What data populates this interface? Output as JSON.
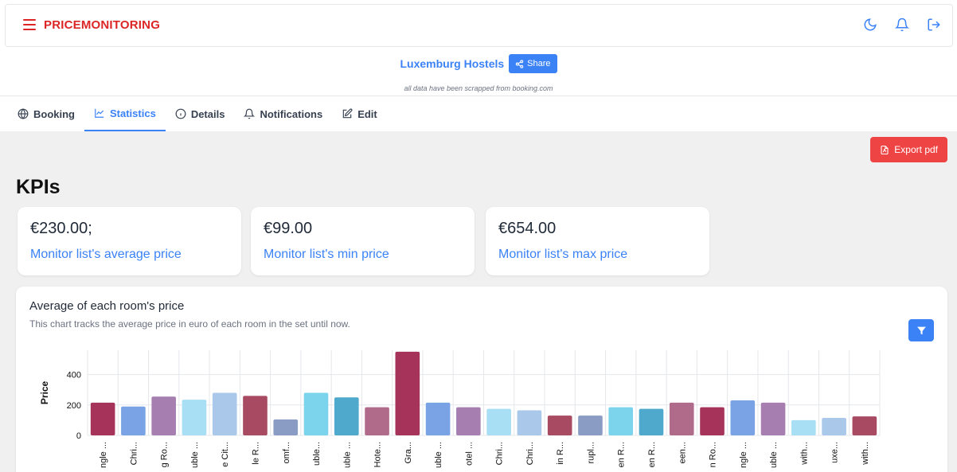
{
  "topbar": {
    "brand": "PRICEMONITORING",
    "icons": [
      "menu-icon",
      "moon-icon",
      "bell-icon",
      "logout-icon"
    ]
  },
  "header": {
    "title": "Luxemburg Hostels",
    "share_label": "Share",
    "note": "all data have been scrapped from booking.com"
  },
  "tabs": [
    {
      "label": "Booking",
      "icon": "globe-icon",
      "active": false
    },
    {
      "label": "Statistics",
      "icon": "chart-line-icon",
      "active": true
    },
    {
      "label": "Details",
      "icon": "info-icon",
      "active": false
    },
    {
      "label": "Notifications",
      "icon": "bell-icon",
      "active": false
    },
    {
      "label": "Edit",
      "icon": "edit-icon",
      "active": false
    }
  ],
  "main": {
    "export_label": "Export pdf",
    "kpis_title": "KPIs",
    "kpis": [
      {
        "value": "€230.00;",
        "label": "Monitor list's average price"
      },
      {
        "value": "€99.00",
        "label": "Monitor list's min price"
      },
      {
        "value": "€654.00",
        "label": "Monitor list's max price"
      }
    ],
    "chart_title": "Average of each room's price",
    "chart_subtitle": "This chart tracks the average price in euro of each room in the set until now."
  },
  "colors": {
    "brand": "#dc2626",
    "accent": "#3b82f6",
    "export": "#ef4444"
  },
  "chart_data": {
    "type": "bar",
    "ylabel": "Price",
    "ylim": [
      0,
      560
    ],
    "yticks": [
      0,
      200,
      400
    ],
    "grid": true,
    "categories": [
      "ngle ...",
      "Chri...",
      "g Ro...",
      "uble ...",
      "e Cit...",
      "le R...",
      "omf...",
      "uble...",
      "uble ...",
      "Hote...",
      "Gra...",
      "uble ...",
      "otel ...",
      "Chri...",
      "Chri...",
      "in R...",
      "rupl...",
      "en R...",
      "en R...",
      "een...",
      "n Ro...",
      "ngle ...",
      "uble ...",
      "with...",
      "uxe...",
      "with..."
    ],
    "values": [
      215,
      190,
      255,
      235,
      280,
      260,
      105,
      280,
      250,
      185,
      550,
      215,
      185,
      175,
      165,
      130,
      130,
      185,
      175,
      215,
      185,
      230,
      215,
      100,
      115,
      125
    ],
    "colors": [
      "#a6345a",
      "#7aa3e5",
      "#a67fb0",
      "#a8dff5",
      "#a9c8ea",
      "#a84a62",
      "#8a9bc4",
      "#7cd3ec",
      "#4fa9cc",
      "#b06a8a",
      "#a6345a",
      "#7aa3e5",
      "#a67fb0",
      "#a8dff5",
      "#a9c8ea",
      "#a84a62",
      "#8a9bc4",
      "#7cd3ec",
      "#4fa9cc",
      "#b06a8a",
      "#a6345a",
      "#7aa3e5",
      "#a67fb0",
      "#a8dff5",
      "#a9c8ea",
      "#a84a62"
    ]
  }
}
